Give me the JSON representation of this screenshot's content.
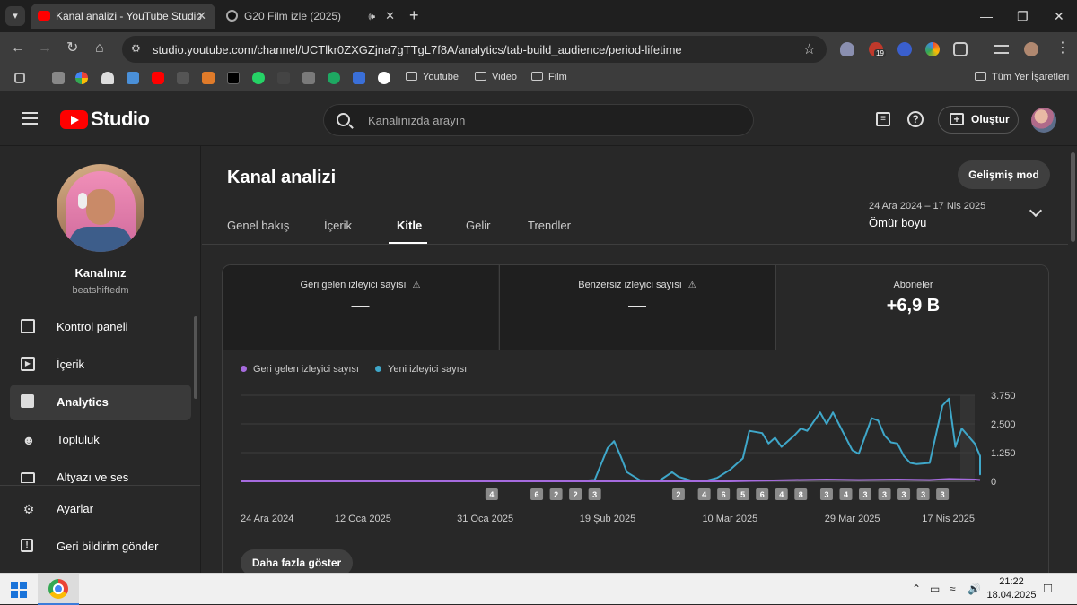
{
  "browser": {
    "tabs": [
      {
        "title": "Kanal analizi - YouTube Studio",
        "active": true
      },
      {
        "title": "G20 Film izle (2025)",
        "active": false
      }
    ],
    "url": "studio.youtube.com/channel/UCTlkr0ZXGZjna7gTTgL7f8A/analytics/tab-build_audience/period-lifetime",
    "extension_badge": "19",
    "bookmarks": {
      "folders": [
        "Youtube",
        "Video",
        "Film"
      ],
      "all_bookmarks": "Tüm Yer İşaretleri"
    }
  },
  "studio": {
    "logo_text": "Studio",
    "search_placeholder": "Kanalınızda arayın",
    "create_label": "Oluştur",
    "channel": {
      "name": "Kanalınız",
      "handle": "beatshiftedm"
    },
    "nav": [
      {
        "label": "Kontrol paneli",
        "icon": "dashboard-icon"
      },
      {
        "label": "İçerik",
        "icon": "content-icon"
      },
      {
        "label": "Analytics",
        "icon": "analytics-icon",
        "active": true
      },
      {
        "label": "Topluluk",
        "icon": "community-icon"
      },
      {
        "label": "Altyazı ve ses",
        "icon": "subtitles-icon"
      }
    ],
    "nav_bottom": [
      {
        "label": "Ayarlar",
        "icon": "settings-icon"
      },
      {
        "label": "Geri bildirim gönder",
        "icon": "feedback-icon"
      }
    ]
  },
  "analytics": {
    "title": "Kanal analizi",
    "advanced_mode": "Gelişmiş mod",
    "tabs": [
      "Genel bakış",
      "İçerik",
      "Kitle",
      "Gelir",
      "Trendler"
    ],
    "active_tab": "Kitle",
    "period": {
      "range": "24 Ara 2024 – 17 Nis 2025",
      "label": "Ömür boyu"
    },
    "metrics": [
      {
        "label": "Geri gelen izleyici sayısı",
        "value": "—",
        "warning": true
      },
      {
        "label": "Benzersiz izleyici sayısı",
        "value": "—",
        "warning": true
      },
      {
        "label": "Aboneler",
        "value": "+6,9 B",
        "warning": false
      }
    ],
    "legend": [
      {
        "label": "Geri gelen izleyici sayısı",
        "color": "#a66bde"
      },
      {
        "label": "Yeni izleyici sayısı",
        "color": "#3fa7c9"
      }
    ],
    "show_more": "Daha fazla göster"
  },
  "chart_data": {
    "type": "line",
    "x_tick_labels": [
      "24 Ara 2024",
      "12 Oca 2025",
      "31 Oca 2025",
      "19 Şub 2025",
      "10 Mar 2025",
      "29 Mar 2025",
      "17 Nis 2025"
    ],
    "y_tick_labels": [
      "3.750",
      "2.500",
      "1.250",
      "0"
    ],
    "ylim": [
      0,
      3750
    ],
    "x_start": "2024-12-24",
    "x_end": "2025-04-17",
    "series": [
      {
        "name": "Yeni izleyici sayısı",
        "color": "#3fa7c9",
        "points": [
          [
            "2024-12-24",
            0
          ],
          [
            "2025-01-31",
            0
          ],
          [
            "2025-02-14",
            0
          ],
          [
            "2025-02-17",
            60
          ],
          [
            "2025-02-19",
            1450
          ],
          [
            "2025-02-20",
            1750
          ],
          [
            "2025-02-21",
            1100
          ],
          [
            "2025-02-22",
            400
          ],
          [
            "2025-02-24",
            50
          ],
          [
            "2025-02-27",
            20
          ],
          [
            "2025-03-01",
            400
          ],
          [
            "2025-03-02",
            200
          ],
          [
            "2025-03-04",
            30
          ],
          [
            "2025-03-06",
            0
          ],
          [
            "2025-03-08",
            150
          ],
          [
            "2025-03-10",
            500
          ],
          [
            "2025-03-12",
            1000
          ],
          [
            "2025-03-13",
            2200
          ],
          [
            "2025-03-15",
            2100
          ],
          [
            "2025-03-16",
            1650
          ],
          [
            "2025-03-17",
            1900
          ],
          [
            "2025-03-18",
            1500
          ],
          [
            "2025-03-20",
            2000
          ],
          [
            "2025-03-21",
            2300
          ],
          [
            "2025-03-22",
            2200
          ],
          [
            "2025-03-24",
            3000
          ],
          [
            "2025-03-25",
            2500
          ],
          [
            "2025-03-26",
            3000
          ],
          [
            "2025-03-28",
            1900
          ],
          [
            "2025-03-29",
            1350
          ],
          [
            "2025-03-30",
            1200
          ],
          [
            "2025-04-01",
            2750
          ],
          [
            "2025-04-02",
            2650
          ],
          [
            "2025-04-03",
            2000
          ],
          [
            "2025-04-04",
            1700
          ],
          [
            "2025-04-05",
            1650
          ],
          [
            "2025-04-06",
            1100
          ],
          [
            "2025-04-07",
            800
          ],
          [
            "2025-04-08",
            750
          ],
          [
            "2025-04-10",
            800
          ],
          [
            "2025-04-12",
            3300
          ],
          [
            "2025-04-13",
            3600
          ],
          [
            "2025-04-14",
            1500
          ],
          [
            "2025-04-15",
            2300
          ],
          [
            "2025-04-17",
            1650
          ],
          [
            "2025-04-18",
            1100
          ],
          [
            "2025-04-19",
            300
          ],
          [
            "2025-04-20",
            600
          ],
          [
            "2025-04-21",
            600
          ]
        ]
      },
      {
        "name": "Geri gelen izleyici sayısı",
        "color": "#a66bde",
        "points": [
          [
            "2024-12-24",
            0
          ],
          [
            "2025-03-10",
            0
          ],
          [
            "2025-03-20",
            60
          ],
          [
            "2025-03-25",
            80
          ],
          [
            "2025-03-30",
            60
          ],
          [
            "2025-04-05",
            80
          ],
          [
            "2025-04-10",
            60
          ],
          [
            "2025-04-13",
            100
          ],
          [
            "2025-04-17",
            80
          ],
          [
            "2025-04-21",
            60
          ]
        ]
      }
    ],
    "markers": [
      {
        "label": "4",
        "date": "2025-02-01"
      },
      {
        "label": "6",
        "date": "2025-02-08"
      },
      {
        "label": "2",
        "date": "2025-02-11"
      },
      {
        "label": "2",
        "date": "2025-02-14"
      },
      {
        "label": "3",
        "date": "2025-02-17"
      },
      {
        "label": "2",
        "date": "2025-03-02"
      },
      {
        "label": "4",
        "date": "2025-03-06"
      },
      {
        "label": "6",
        "date": "2025-03-09"
      },
      {
        "label": "5",
        "date": "2025-03-12"
      },
      {
        "label": "6",
        "date": "2025-03-15"
      },
      {
        "label": "4",
        "date": "2025-03-18"
      },
      {
        "label": "8",
        "date": "2025-03-21"
      },
      {
        "label": "3",
        "date": "2025-03-25"
      },
      {
        "label": "4",
        "date": "2025-03-28"
      },
      {
        "label": "3",
        "date": "2025-03-31"
      },
      {
        "label": "3",
        "date": "2025-04-03"
      },
      {
        "label": "3",
        "date": "2025-04-06"
      },
      {
        "label": "3",
        "date": "2025-04-09"
      },
      {
        "label": "3",
        "date": "2025-04-12"
      }
    ]
  },
  "taskbar": {
    "time": "21:22",
    "date": "18.04.2025"
  }
}
